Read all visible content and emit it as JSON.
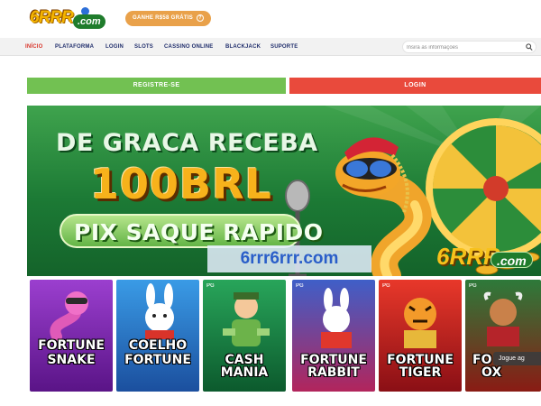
{
  "header": {
    "logo": {
      "num": "6RRR",
      "domain": ".com"
    },
    "promo_button": "GANHE R$58 GRÁTIS"
  },
  "nav": {
    "items": [
      {
        "label": "INÍCIO",
        "active": true
      },
      {
        "label": "PLATAFORMA"
      },
      {
        "label": "LOGIN"
      },
      {
        "label": "SLOTS"
      },
      {
        "label": "CASSINO ONLINE"
      },
      {
        "label": "BLACKJACK"
      },
      {
        "label": "SUPORTE"
      }
    ],
    "search_placeholder": "Insira as informações"
  },
  "actions": {
    "register": "REGISTRE-SE",
    "login": "LOGIN"
  },
  "banner": {
    "line1": "DE GRACA RECEBA",
    "line2": "100BRL",
    "line3": "PIX SAQUE RAPIDO",
    "url": "6rrr6rrr.com",
    "logo_num": "6RRR",
    "logo_domain": ".com"
  },
  "games": [
    {
      "title1": "FORTUNE",
      "title2": "SNAKE",
      "label": "PG"
    },
    {
      "title1": "COELHO",
      "title2": "FORTUNE",
      "label": "PG"
    },
    {
      "title1": "CASH",
      "title2": "MANIA",
      "label": "PG"
    },
    {
      "title1": "FORTUNE",
      "title2": "RABBIT",
      "label": "PG"
    },
    {
      "title1": "FORTUNE",
      "title2": "TIGER",
      "label": "PG"
    },
    {
      "title1": "FO",
      "title2": "OX",
      "label": "PG"
    }
  ],
  "play_tooltip": "Jogue ag",
  "colors": {
    "register": "#72c152",
    "login": "#e94a3c",
    "promo": "#e9a14a",
    "nav_active": "#d9362b",
    "nav": "#1f2d6b"
  }
}
